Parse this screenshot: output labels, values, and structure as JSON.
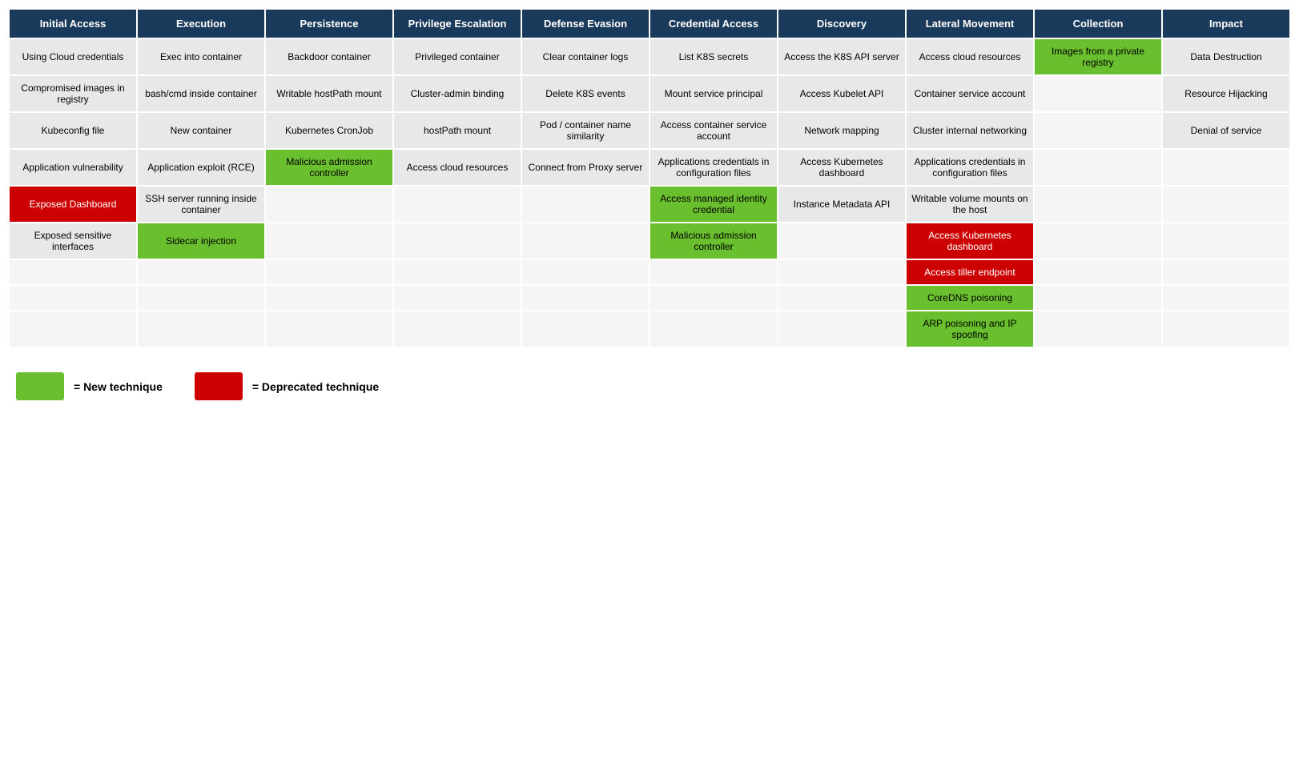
{
  "headers": [
    "Initial Access",
    "Execution",
    "Persistence",
    "Privilege Escalation",
    "Defense Evasion",
    "Credential Access",
    "Discovery",
    "Lateral Movement",
    "Collection",
    "Impact"
  ],
  "rows": [
    [
      {
        "text": "Using Cloud credentials",
        "type": "normal"
      },
      {
        "text": "Exec into container",
        "type": "normal"
      },
      {
        "text": "Backdoor container",
        "type": "normal"
      },
      {
        "text": "Privileged container",
        "type": "normal"
      },
      {
        "text": "Clear container logs",
        "type": "normal"
      },
      {
        "text": "List K8S secrets",
        "type": "normal"
      },
      {
        "text": "Access the K8S API server",
        "type": "normal"
      },
      {
        "text": "Access cloud resources",
        "type": "normal"
      },
      {
        "text": "Images from a private registry",
        "type": "green"
      },
      {
        "text": "Data Destruction",
        "type": "normal"
      }
    ],
    [
      {
        "text": "Compromised images in registry",
        "type": "normal"
      },
      {
        "text": "bash/cmd inside container",
        "type": "normal"
      },
      {
        "text": "Writable hostPath mount",
        "type": "normal"
      },
      {
        "text": "Cluster-admin binding",
        "type": "normal"
      },
      {
        "text": "Delete K8S events",
        "type": "normal"
      },
      {
        "text": "Mount service principal",
        "type": "normal"
      },
      {
        "text": "Access Kubelet API",
        "type": "normal"
      },
      {
        "text": "Container service account",
        "type": "normal"
      },
      {
        "text": "",
        "type": "empty"
      },
      {
        "text": "Resource Hijacking",
        "type": "normal"
      }
    ],
    [
      {
        "text": "Kubeconfig file",
        "type": "normal"
      },
      {
        "text": "New container",
        "type": "normal"
      },
      {
        "text": "Kubernetes CronJob",
        "type": "normal"
      },
      {
        "text": "hostPath mount",
        "type": "normal"
      },
      {
        "text": "Pod / container name similarity",
        "type": "normal"
      },
      {
        "text": "Access container service account",
        "type": "normal"
      },
      {
        "text": "Network mapping",
        "type": "normal"
      },
      {
        "text": "Cluster internal networking",
        "type": "normal"
      },
      {
        "text": "",
        "type": "empty"
      },
      {
        "text": "Denial of service",
        "type": "normal"
      }
    ],
    [
      {
        "text": "Application vulnerability",
        "type": "normal"
      },
      {
        "text": "Application exploit (RCE)",
        "type": "normal"
      },
      {
        "text": "Malicious admission controller",
        "type": "green"
      },
      {
        "text": "Access cloud resources",
        "type": "normal"
      },
      {
        "text": "Connect from Proxy server",
        "type": "normal"
      },
      {
        "text": "Applications credentials in configuration files",
        "type": "normal"
      },
      {
        "text": "Access Kubernetes dashboard",
        "type": "normal"
      },
      {
        "text": "Applications credentials in configuration files",
        "type": "normal"
      },
      {
        "text": "",
        "type": "empty"
      },
      {
        "text": "",
        "type": "empty"
      }
    ],
    [
      {
        "text": "Exposed Dashboard",
        "type": "red"
      },
      {
        "text": "SSH server running inside container",
        "type": "normal"
      },
      {
        "text": "",
        "type": "empty"
      },
      {
        "text": "",
        "type": "empty"
      },
      {
        "text": "",
        "type": "empty"
      },
      {
        "text": "Access managed identity credential",
        "type": "green"
      },
      {
        "text": "Instance Metadata API",
        "type": "normal"
      },
      {
        "text": "Writable volume mounts on the host",
        "type": "normal"
      },
      {
        "text": "",
        "type": "empty"
      },
      {
        "text": "",
        "type": "empty"
      }
    ],
    [
      {
        "text": "Exposed sensitive interfaces",
        "type": "normal"
      },
      {
        "text": "Sidecar injection",
        "type": "green"
      },
      {
        "text": "",
        "type": "empty"
      },
      {
        "text": "",
        "type": "empty"
      },
      {
        "text": "",
        "type": "empty"
      },
      {
        "text": "Malicious admission controller",
        "type": "green"
      },
      {
        "text": "",
        "type": "empty"
      },
      {
        "text": "Access Kubernetes dashboard",
        "type": "red"
      },
      {
        "text": "",
        "type": "empty"
      },
      {
        "text": "",
        "type": "empty"
      }
    ],
    [
      {
        "text": "",
        "type": "empty"
      },
      {
        "text": "",
        "type": "empty"
      },
      {
        "text": "",
        "type": "empty"
      },
      {
        "text": "",
        "type": "empty"
      },
      {
        "text": "",
        "type": "empty"
      },
      {
        "text": "",
        "type": "empty"
      },
      {
        "text": "",
        "type": "empty"
      },
      {
        "text": "Access tiller endpoint",
        "type": "red"
      },
      {
        "text": "",
        "type": "empty"
      },
      {
        "text": "",
        "type": "empty"
      }
    ],
    [
      {
        "text": "",
        "type": "empty"
      },
      {
        "text": "",
        "type": "empty"
      },
      {
        "text": "",
        "type": "empty"
      },
      {
        "text": "",
        "type": "empty"
      },
      {
        "text": "",
        "type": "empty"
      },
      {
        "text": "",
        "type": "empty"
      },
      {
        "text": "",
        "type": "empty"
      },
      {
        "text": "CoreDNS poisoning",
        "type": "green"
      },
      {
        "text": "",
        "type": "empty"
      },
      {
        "text": "",
        "type": "empty"
      }
    ],
    [
      {
        "text": "",
        "type": "empty"
      },
      {
        "text": "",
        "type": "empty"
      },
      {
        "text": "",
        "type": "empty"
      },
      {
        "text": "",
        "type": "empty"
      },
      {
        "text": "",
        "type": "empty"
      },
      {
        "text": "",
        "type": "empty"
      },
      {
        "text": "",
        "type": "empty"
      },
      {
        "text": "ARP poisoning and IP spoofing",
        "type": "green"
      },
      {
        "text": "",
        "type": "empty"
      },
      {
        "text": "",
        "type": "empty"
      }
    ]
  ],
  "legend": {
    "new_label": "= New technique",
    "deprecated_label": "= Deprecated technique"
  }
}
